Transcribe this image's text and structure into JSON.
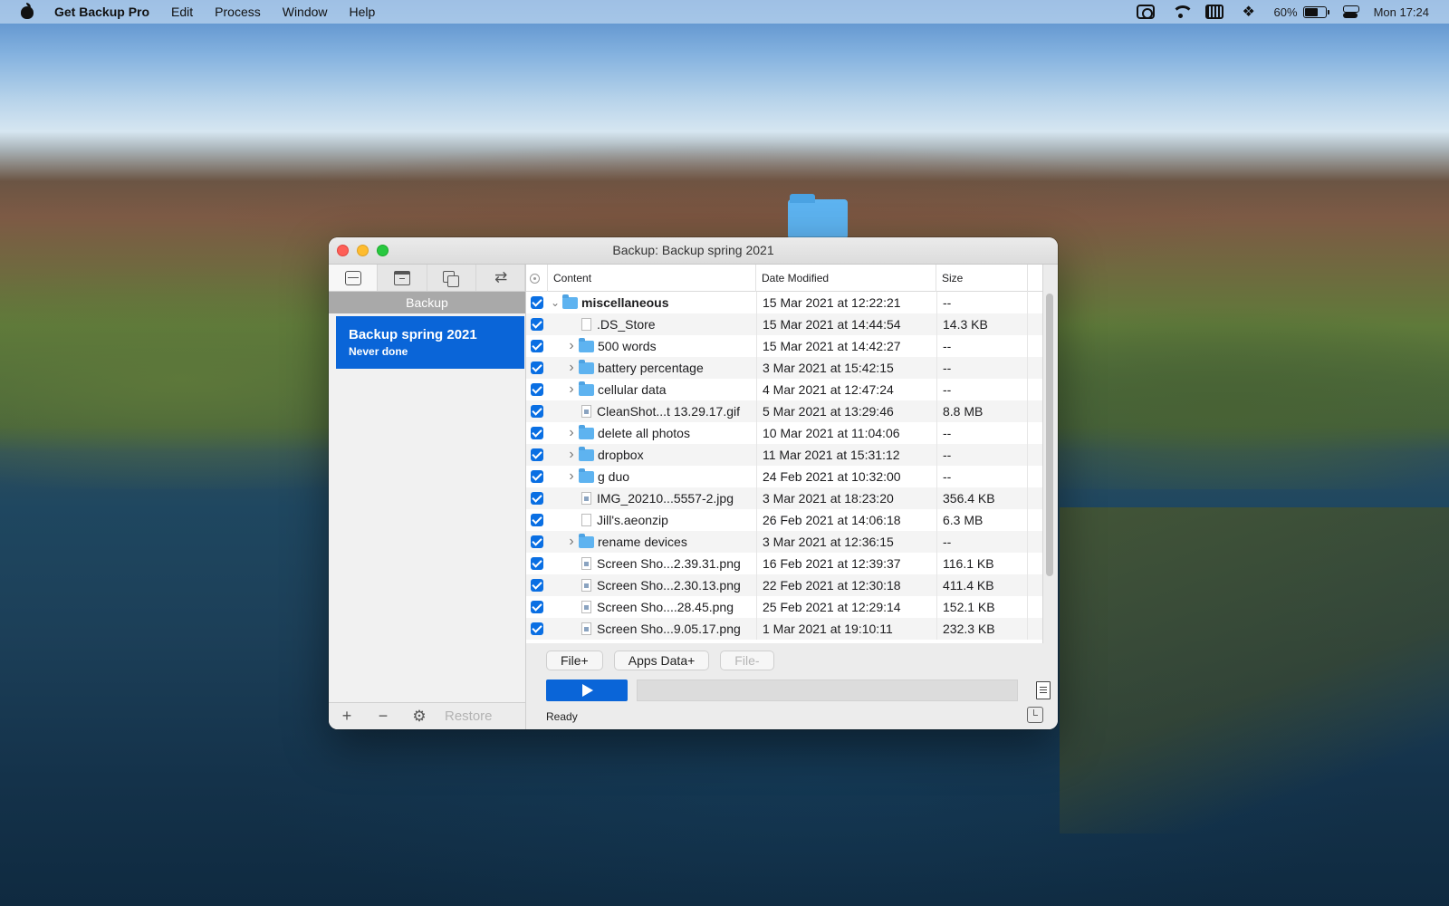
{
  "menubar": {
    "app_name": "Get Backup Pro",
    "menus": [
      "Edit",
      "Process",
      "Window",
      "Help"
    ],
    "battery_percent": "60%",
    "clock": "Mon 17:24"
  },
  "window": {
    "title": "Backup: Backup spring 2021"
  },
  "sidebar": {
    "header": "Backup",
    "tabs": [
      "drive-icon",
      "archive-icon",
      "clone-icon",
      "sync-icon"
    ],
    "items": [
      {
        "title": "Backup spring 2021",
        "subtitle": "Never done"
      }
    ],
    "bottom": {
      "add": "+",
      "remove": "−",
      "restore": "Restore"
    }
  },
  "table": {
    "columns": {
      "content": "Content",
      "date": "Date Modified",
      "size": "Size"
    },
    "rows": [
      {
        "name": "miscellaneous",
        "date": "15 Mar 2021 at 12:22:21",
        "size": "--",
        "kind": "root-folder"
      },
      {
        "name": ".DS_Store",
        "date": "15 Mar 2021 at 14:44:54",
        "size": "14.3 KB",
        "kind": "file"
      },
      {
        "name": "500 words",
        "date": "15 Mar 2021 at 14:42:27",
        "size": "--",
        "kind": "folder"
      },
      {
        "name": "battery percentage",
        "date": "3 Mar 2021 at 15:42:15",
        "size": "--",
        "kind": "folder"
      },
      {
        "name": "cellular data",
        "date": "4 Mar 2021 at 12:47:24",
        "size": "--",
        "kind": "folder"
      },
      {
        "name": "CleanShot...t 13.29.17.gif",
        "date": "5 Mar 2021 at 13:29:46",
        "size": "8.8 MB",
        "kind": "image"
      },
      {
        "name": "delete all photos",
        "date": "10 Mar 2021 at 11:04:06",
        "size": "--",
        "kind": "folder"
      },
      {
        "name": "dropbox",
        "date": "11 Mar 2021 at 15:31:12",
        "size": "--",
        "kind": "folder"
      },
      {
        "name": "g duo",
        "date": "24 Feb 2021 at 10:32:00",
        "size": "--",
        "kind": "folder"
      },
      {
        "name": "IMG_20210...5557-2.jpg",
        "date": "3 Mar 2021 at 18:23:20",
        "size": "356.4 KB",
        "kind": "image"
      },
      {
        "name": "Jill's.aeonzip",
        "date": "26 Feb 2021 at 14:06:18",
        "size": "6.3 MB",
        "kind": "file"
      },
      {
        "name": "rename devices",
        "date": "3 Mar 2021 at 12:36:15",
        "size": "--",
        "kind": "folder"
      },
      {
        "name": "Screen Sho...2.39.31.png",
        "date": "16 Feb 2021 at 12:39:37",
        "size": "116.1 KB",
        "kind": "image"
      },
      {
        "name": "Screen Sho...2.30.13.png",
        "date": "22 Feb 2021 at 12:30:18",
        "size": "411.4 KB",
        "kind": "image"
      },
      {
        "name": "Screen Sho....28.45.png",
        "date": "25 Feb 2021 at 12:29:14",
        "size": "152.1 KB",
        "kind": "image"
      },
      {
        "name": "Screen Sho...9.05.17.png",
        "date": "1 Mar 2021 at 19:10:11",
        "size": "232.3 KB",
        "kind": "image"
      }
    ]
  },
  "actions": {
    "file_plus": "File+",
    "apps_data_plus": "Apps Data+",
    "file_minus": "File-"
  },
  "status": {
    "text": "Ready",
    "progress": 0
  },
  "colors": {
    "accent": "#0a65d8",
    "checkbox": "#0a6fe3",
    "folder": "#5eb3f0"
  }
}
